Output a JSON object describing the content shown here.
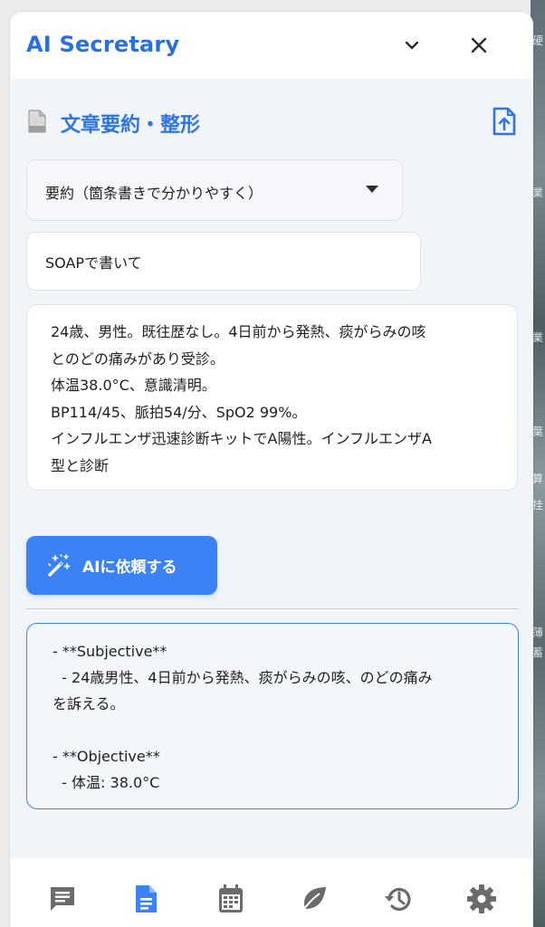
{
  "background": {
    "glyphs": [
      "硬",
      "業",
      "業",
      "葉",
      "算",
      "挂",
      "薄",
      "蓄"
    ]
  },
  "header": {
    "title": "AI Secretary",
    "collapse_icon": "chevron-down-icon",
    "close_icon": "close-icon"
  },
  "section": {
    "title": "文章要約・整形",
    "icon": "document-icon",
    "upload_icon": "upload-file-icon"
  },
  "form": {
    "mode_select": {
      "value": "要約（箇条書きで分かりやすく）"
    },
    "instruction": {
      "value": "SOAPで書いて"
    },
    "input_lines": [
      "24歳、男性。既往歴なし。4日前から発熱、痰がらみの咳",
      "とのどの痛みがあり受診。",
      "体温38.0°C、意識清明。",
      "BP114/45、脈拍54/分、SpO2 99%。",
      "インフルエンザ迅速診断キットでA陽性。インフルエンザA",
      "型と診断"
    ],
    "submit_label": "AIに依頼する"
  },
  "output": {
    "lines": [
      "- **Subjective**",
      "  - 24歳男性、4日前から発熱、痰がらみの咳、のどの痛み",
      "を訴える。",
      "",
      "- **Objective**",
      "  - 体温: 38.0°C"
    ]
  },
  "nav": {
    "items": [
      {
        "name": "chat",
        "icon": "chat-icon",
        "active": false
      },
      {
        "name": "document",
        "icon": "document-icon",
        "active": true
      },
      {
        "name": "calendar",
        "icon": "calendar-icon",
        "active": false
      },
      {
        "name": "leaf",
        "icon": "leaf-icon",
        "active": false
      },
      {
        "name": "history",
        "icon": "history-icon",
        "active": false
      },
      {
        "name": "settings",
        "icon": "gear-icon",
        "active": false
      }
    ]
  },
  "colors": {
    "accent": "#3b82f6",
    "title": "#2a6fe0",
    "nav_inactive": "#6b6b6b",
    "panel_bg": "#f1f4f8"
  }
}
